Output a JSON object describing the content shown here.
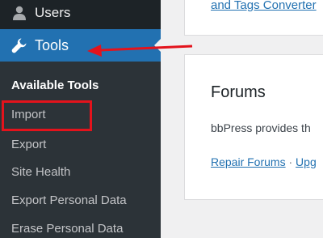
{
  "sidebar": {
    "menu": [
      {
        "label": "Users",
        "icon": "user-icon"
      },
      {
        "label": "Tools",
        "icon": "wrench-icon",
        "active": true
      }
    ],
    "submenu_heading": "Available Tools",
    "submenu": [
      "Import",
      "Export",
      "Site Health",
      "Export Personal Data",
      "Erase Personal Data"
    ]
  },
  "main": {
    "top_card_link": "and Tags Converter",
    "forums": {
      "title": "Forums",
      "description": "bbPress provides th",
      "repair_link": "Repair Forums",
      "separator": "·",
      "partial_link": "Upg"
    }
  },
  "annotations": {
    "color": "#e3131c"
  },
  "colors": {
    "sidebar_bg": "#1d2327",
    "submenu_bg": "#2c3338",
    "active_bg": "#2271b1",
    "link": "#2271b1"
  }
}
